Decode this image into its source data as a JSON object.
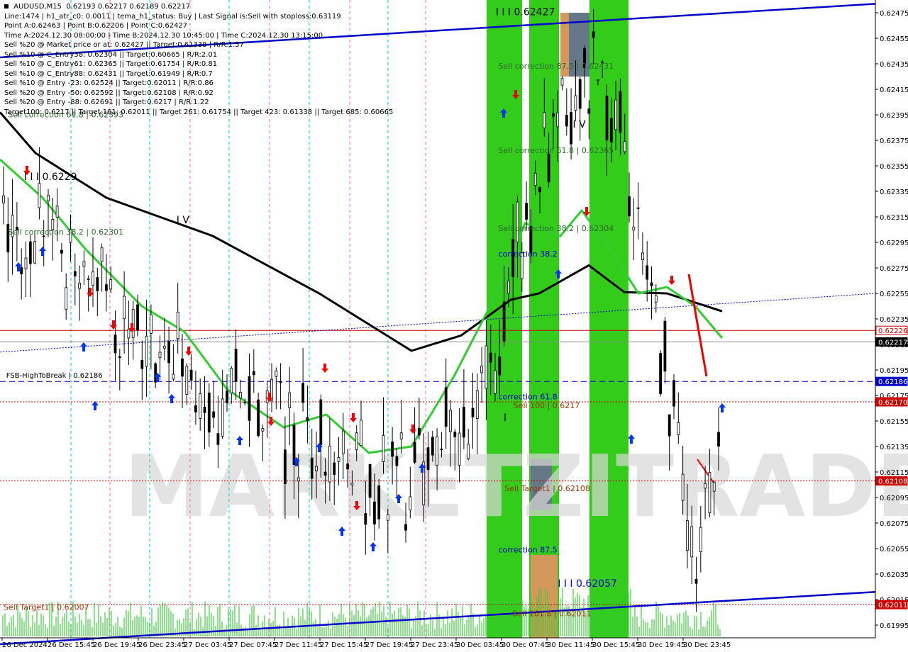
{
  "header": {
    "symbol": "AUDUSD,M15",
    "ohlc": "0.62193 0.62217 0.62189 0.62217",
    "lines": [
      "Line:1474 | h1_atr_c0: 0.0011 | tema_h1_status: Buy | Last Signal is:Sell with stoploss:0.63119",
      "Point A:0.62463 | Point B:0.62206 | Point C:0.62427",
      "Time A:2024.12.30 08:00:00 | Time B:2024.12.30 10:45:00 | Time C:2024.12.30 13:15:00",
      "Sell %20 @ Market price or at: 0.62427 || Target:0.61338 | R/R:1.57",
      "Sell %10 @ C_Entry38: 0.62304 || Target:0.60665 | R/R:2.01",
      "Sell %10 @ C_Entry61: 0.62365 || Target:0.61754 | R/R:0.81",
      "Sell %10 @ C_Entry88: 0.62431 || Target:0.61949 | R/R:0.7",
      "Sell %10 @ Entry -23: 0.62524 || Target:0.62011 | R/R:0.86",
      "Sell %20 @ Entry -50: 0.62592 || Target:0.62108 | R/R:0.92",
      "Sell %20 @ Entry -88: 0.62691 || Target:0.6217 | R/R:1.22",
      "Target100: 0.6217 || Target 161: 0.62011 || Target 261: 0.61754 || Target 423: 0.61338 || Target 685: 0.60665"
    ]
  },
  "watermark": "MARKETZITRADE",
  "colors": {
    "background": "#ffffff",
    "bull": "#000000",
    "bear": "#000000",
    "ma_green": "#33cc33",
    "ma_black": "#000000",
    "channel": "#0000cc",
    "zone_green": "#33cc1a",
    "zone_gray": "#667788",
    "zone_orange": "#d4995a",
    "red_line": "#cc0000",
    "dashed_blue": "#0000cc",
    "dashed_red": "#cc0000",
    "vlines_cyan": "#00cccc",
    "vlines_pink": "#ff66cc",
    "volume": "#33cc33"
  },
  "chart_data": {
    "type": "candlestick",
    "ylim": [
      0.61985,
      0.62485
    ],
    "y_ticks": [
      "0.62475",
      "0.62455",
      "0.62435",
      "0.62415",
      "0.62395",
      "0.62375",
      "0.62355",
      "0.62335",
      "0.62315",
      "0.62295",
      "0.62275",
      "0.62255",
      "0.62235",
      "0.62215",
      "0.62195",
      "0.62175",
      "0.62155",
      "0.62135",
      "0.62115",
      "0.62095",
      "0.62075",
      "0.62055",
      "0.62035",
      "0.62015",
      "0.61995"
    ],
    "x_ticks": [
      "26 Dec 2024",
      "26 Dec 15:45",
      "26 Dec 19:45",
      "26 Dec 23:45",
      "27 Dec 03:45",
      "27 Dec 07:45",
      "27 Dec 11:45",
      "27 Dec 15:45",
      "27 Dec 19:45",
      "27 Dec 23:45",
      "30 Dec 03:45",
      "30 Dec 07:45",
      "30 Dec 11:45",
      "30 Dec 15:45",
      "30 Dec 19:45",
      "30 Dec 23:45"
    ],
    "price_labels": [
      {
        "value": 0.62226,
        "text": "0.62226",
        "style": "red-outline"
      },
      {
        "value": 0.62217,
        "text": "0.62217",
        "style": "black"
      },
      {
        "value": 0.62186,
        "text": "0.62186",
        "style": "blue"
      },
      {
        "value": 0.6217,
        "text": "0.62170",
        "style": "red"
      },
      {
        "value": 0.62108,
        "text": "0.62108",
        "style": "red"
      },
      {
        "value": 0.62011,
        "text": "0.62011",
        "style": "red"
      }
    ],
    "horizontal_lines": [
      {
        "value": 0.62226,
        "style": "solid",
        "color": "#cc0000"
      },
      {
        "value": 0.62217,
        "style": "solid",
        "color": "#888888"
      },
      {
        "value": 0.62186,
        "style": "dashed",
        "color": "#0000cc"
      },
      {
        "value": 0.6217,
        "style": "dotted",
        "color": "#cc0000"
      },
      {
        "value": 0.62108,
        "style": "dotted",
        "color": "#cc0000"
      },
      {
        "value": 0.62011,
        "style": "dotted",
        "color": "#cc0000"
      }
    ],
    "annotations": [
      {
        "text": "I I I 0.62427",
        "x": 55.5,
        "y": 0.62473,
        "color": "#000000",
        "size": 14
      },
      {
        "text": "Sell correction 87.5 | 0.62431",
        "x": 55.8,
        "y": 0.62431,
        "color": "#2e6b2e",
        "size": 11
      },
      {
        "text": "I V",
        "x": 64.2,
        "y": 0.62385,
        "color": "#000000",
        "size": 14
      },
      {
        "text": "Sell correction 61.8 | 0.62365",
        "x": 55.8,
        "y": 0.62365,
        "color": "#2e6b2e",
        "size": 11
      },
      {
        "text": "Sell correction 38.2 | 0.62304",
        "x": 55.8,
        "y": 0.62304,
        "color": "#2e6b2e",
        "size": 11
      },
      {
        "text": "correction 38.2",
        "x": 55.8,
        "y": 0.62284,
        "color": "#0000cc",
        "size": 11
      },
      {
        "text": "Sell correction 61.8 | 0.62393",
        "x": 0.5,
        "y": 0.62393,
        "color": "#2e6b2e",
        "size": 11
      },
      {
        "text": "I I I 0.6229",
        "x": 2.3,
        "y": 0.62344,
        "color": "#000000",
        "size": 14
      },
      {
        "text": "I V",
        "x": 19.5,
        "y": 0.6231,
        "color": "#000000",
        "size": 14
      },
      {
        "text": "Sell correction 38.2 | 0.62301",
        "x": 0.5,
        "y": 0.62301,
        "color": "#2e6b2e",
        "size": 11
      },
      {
        "text": "FSB-HighToBreak | 0.62186",
        "x": 0.3,
        "y": 0.62189,
        "color": "#000000",
        "size": 10
      },
      {
        "text": "correction 61.8",
        "x": 55.8,
        "y": 0.62172,
        "color": "#0000cc",
        "size": 11
      },
      {
        "text": "Sell 100 | 0.6217",
        "x": 57.5,
        "y": 0.62165,
        "color": "#993300",
        "size": 11
      },
      {
        "text": "I",
        "x": 56.4,
        "y": 0.62155,
        "color": "#000000",
        "size": 14
      },
      {
        "text": "Sell Target1 | 0.62108",
        "x": 56.5,
        "y": 0.621,
        "color": "#993300",
        "size": 11
      },
      {
        "text": "correction 87.5",
        "x": 55.8,
        "y": 0.62052,
        "color": "#0000cc",
        "size": 11
      },
      {
        "text": "I I I 0.62057",
        "x": 62.5,
        "y": 0.62025,
        "color": "#0000cc",
        "size": 14
      },
      {
        "text": "Sell Target1 | 0.62007",
        "x": 0,
        "y": 0.62007,
        "color": "#993300",
        "size": 11
      },
      {
        "text": "Sell 161.8 | 0.62011",
        "x": 57.4,
        "y": 0.62002,
        "color": "#993300",
        "size": 11
      }
    ],
    "n_candles": 82
  }
}
